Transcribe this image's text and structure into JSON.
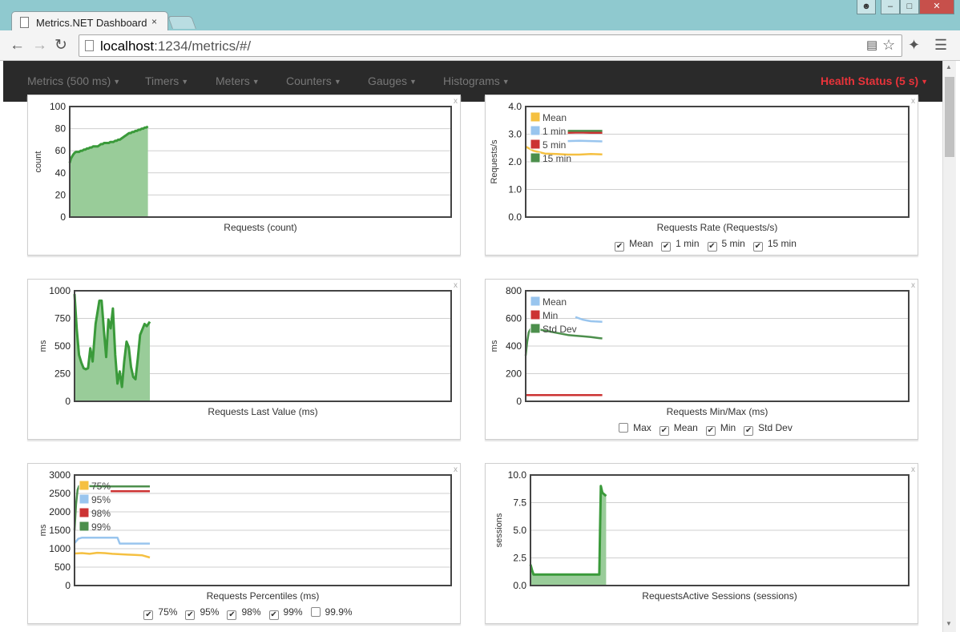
{
  "browser": {
    "tab_title": "Metrics.NET Dashboard",
    "tab_close": "×",
    "url_host": "localhost",
    "url_rest": ":1234/metrics/#/"
  },
  "navbar": {
    "items": [
      "Metrics (500 ms)",
      "Timers",
      "Meters",
      "Counters",
      "Gauges",
      "Histograms"
    ],
    "health": "Health Status (5 s)"
  },
  "colors": {
    "green": "#3a9a3a",
    "green_fill": "#99cc99",
    "yellow": "#f5c041",
    "blue": "#99c5ee",
    "red": "#cc3333",
    "dkgreen": "#4c8f4c",
    "health": "#e8333a"
  },
  "panels": [
    {
      "close": "x",
      "title": "Requests (count)",
      "ylabel": "count",
      "checks": [],
      "chart_data": {
        "type": "area",
        "ylim": [
          0,
          100
        ],
        "yticks": [
          "0",
          "20",
          "40",
          "60",
          "80",
          "100"
        ],
        "x_extent": [
          0,
          100
        ],
        "series": [
          {
            "color": "#3a9a3a",
            "fill": true,
            "x": [
              0,
              1.5,
              4,
              6,
              8,
              10,
              12,
              14,
              16,
              18,
              20,
              22,
              24,
              26,
              28,
              30,
              32,
              34,
              36,
              38,
              40,
              42,
              44,
              46,
              48,
              50,
              52,
              54,
              56,
              58,
              60,
              62,
              64,
              66,
              68,
              70,
              72,
              74,
              76,
              78,
              80,
              82,
              84,
              86,
              88,
              90,
              92,
              94,
              96,
              98,
              100
            ],
            "y": [
              49,
              53,
              56,
              58,
              59,
              59,
              59,
              60,
              60,
              61,
              61,
              62,
              62,
              63,
              63,
              64,
              64,
              64,
              64,
              65,
              66,
              66,
              67,
              67,
              67,
              67,
              68,
              68,
              68,
              69,
              69,
              70,
              70,
              71,
              72,
              73,
              74,
              75,
              76,
              76,
              77,
              77,
              78,
              78,
              79,
              79,
              80,
              80,
              81,
              81,
              82
            ]
          }
        ]
      }
    },
    {
      "close": "x",
      "title": "Requests Rate (Requests/s)",
      "ylabel": "Requests/s",
      "checks": [
        {
          "label": "Mean",
          "checked": true
        },
        {
          "label": "1 min",
          "checked": true
        },
        {
          "label": "5 min",
          "checked": true
        },
        {
          "label": "15 min",
          "checked": true
        }
      ],
      "legend": [
        "Mean",
        "1 min",
        "5 min",
        "15 min"
      ],
      "chart_data": {
        "type": "line",
        "ylim": [
          0,
          4
        ],
        "yticks": [
          "0.0",
          "1.0",
          "2.0",
          "3.0",
          "4.0"
        ],
        "x_extent": [
          0,
          100
        ],
        "series": [
          {
            "name": "Mean",
            "color": "#f5c041",
            "x": [
              0,
              10,
              25,
              40,
              55,
              70,
              85,
              100
            ],
            "y": [
              2.55,
              2.4,
              2.3,
              2.28,
              2.26,
              2.26,
              2.28,
              2.27
            ]
          },
          {
            "name": "1 min",
            "color": "#99c5ee",
            "x": [
              55,
              70,
              85,
              100
            ],
            "y": [
              2.75,
              2.76,
              2.75,
              2.74
            ]
          },
          {
            "name": "5 min",
            "color": "#cc3333",
            "x": [
              55,
              70,
              85,
              100
            ],
            "y": [
              3.05,
              3.06,
              3.05,
              3.05
            ]
          },
          {
            "name": "15 min",
            "color": "#4c8f4c",
            "x": [
              55,
              70,
              85,
              100
            ],
            "y": [
              3.12,
              3.12,
              3.12,
              3.12
            ]
          }
        ]
      }
    },
    {
      "close": "x",
      "title": "Requests Last Value (ms)",
      "ylabel": "ms",
      "checks": [],
      "chart_data": {
        "type": "area",
        "ylim": [
          0,
          1000
        ],
        "yticks": [
          "0",
          "250",
          "500",
          "750",
          "1000"
        ],
        "x_extent": [
          0,
          100
        ],
        "series": [
          {
            "color": "#3a9a3a",
            "fill": true,
            "x": [
              0,
              3,
              6,
              9,
              12,
              15,
              18,
              21,
              24,
              28,
              33,
              36,
              39,
              42,
              45,
              48,
              51,
              54,
              57,
              60,
              63,
              66,
              69,
              72,
              75,
              78,
              81,
              84,
              87,
              90,
              93,
              96,
              100
            ],
            "y": [
              970,
              650,
              420,
              350,
              300,
              290,
              300,
              480,
              360,
              700,
              910,
              910,
              640,
              400,
              740,
              660,
              840,
              420,
              160,
              270,
              130,
              360,
              540,
              490,
              310,
              220,
              200,
              390,
              600,
              650,
              700,
              680,
              720
            ]
          }
        ]
      }
    },
    {
      "close": "x",
      "title": "Requests Min/Max (ms)",
      "ylabel": "ms",
      "checks": [
        {
          "label": "Max",
          "checked": false
        },
        {
          "label": "Mean",
          "checked": true
        },
        {
          "label": "Min",
          "checked": true
        },
        {
          "label": "Std Dev",
          "checked": true
        }
      ],
      "legend": [
        "Mean",
        "Min",
        "Std Dev"
      ],
      "chart_data": {
        "type": "line",
        "ylim": [
          0,
          800
        ],
        "yticks": [
          "0",
          "200",
          "400",
          "600",
          "800"
        ],
        "x_extent": [
          0,
          100
        ],
        "series": [
          {
            "name": "Mean",
            "color": "#99c5ee",
            "x": [
              65,
              70,
              75,
              80,
              85,
              90,
              95,
              100
            ],
            "y": [
              610,
              600,
              590,
              585,
              580,
              578,
              577,
              575
            ]
          },
          {
            "name": "Min",
            "color": "#cc3333",
            "x": [
              0,
              25,
              50,
              75,
              100
            ],
            "y": [
              45,
              45,
              45,
              45,
              45
            ]
          },
          {
            "name": "Std Dev",
            "color": "#4c8f4c",
            "x": [
              0,
              2,
              4,
              6,
              8,
              55,
              65,
              75,
              85,
              95,
              100
            ],
            "y": [
              330,
              430,
              500,
              520,
              530,
              480,
              475,
              470,
              465,
              458,
              455
            ]
          }
        ]
      }
    },
    {
      "close": "x",
      "title": "Requests Percentiles (ms)",
      "ylabel": "ms",
      "checks": [
        {
          "label": "75%",
          "checked": true
        },
        {
          "label": "95%",
          "checked": true
        },
        {
          "label": "98%",
          "checked": true
        },
        {
          "label": "99%",
          "checked": true
        },
        {
          "label": "99.9%",
          "checked": false
        }
      ],
      "legend": [
        "75%",
        "95%",
        "98%",
        "99%"
      ],
      "chart_data": {
        "type": "line",
        "ylim": [
          0,
          3000
        ],
        "yticks": [
          "0",
          "500",
          "1000",
          "1500",
          "2000",
          "2500",
          "3000"
        ],
        "x_extent": [
          0,
          100
        ],
        "series": [
          {
            "name": "75%",
            "color": "#f5c041",
            "x": [
              0,
              10,
              20,
              30,
              40,
              50,
              60,
              70,
              80,
              90,
              100
            ],
            "y": [
              870,
              880,
              860,
              890,
              880,
              860,
              850,
              840,
              830,
              820,
              760
            ]
          },
          {
            "name": "95%",
            "color": "#99c5ee",
            "x": [
              0,
              5,
              10,
              20,
              30,
              40,
              50,
              57,
              60,
              70,
              80,
              90,
              100
            ],
            "y": [
              1150,
              1270,
              1300,
              1300,
              1300,
              1300,
              1300,
              1300,
              1140,
              1140,
              1140,
              1140,
              1140
            ]
          },
          {
            "name": "98%",
            "color": "#cc3333",
            "x": [
              48,
              60,
              70,
              80,
              90,
              100
            ],
            "y": [
              2560,
              2560,
              2560,
              2560,
              2560,
              2560
            ]
          },
          {
            "name": "99%",
            "color": "#4c8f4c",
            "x": [
              0,
              2,
              4,
              6,
              48,
              60,
              70,
              80,
              90,
              100
            ],
            "y": [
              1500,
              2200,
              2600,
              2700,
              2690,
              2690,
              2690,
              2690,
              2690,
              2690
            ]
          }
        ]
      }
    },
    {
      "close": "x",
      "title": "RequestsActive Sessions (sessions)",
      "ylabel": "sessions",
      "checks": [],
      "chart_data": {
        "type": "area",
        "ylim": [
          0,
          10
        ],
        "yticks": [
          "0.0",
          "2.5",
          "5.0",
          "7.5",
          "10.0"
        ],
        "x_extent": [
          0,
          100
        ],
        "series": [
          {
            "color": "#3a9a3a",
            "fill": true,
            "x": [
              0,
              2,
              4,
              8,
              20,
              40,
              60,
              80,
              90,
              91,
              92,
              93,
              94,
              95,
              100
            ],
            "y": [
              1.9,
              1.4,
              1.0,
              1.0,
              1.0,
              1.0,
              1.0,
              1.0,
              1.0,
              1.0,
              5.0,
              9.0,
              8.7,
              8.4,
              8.1
            ]
          }
        ]
      }
    }
  ]
}
